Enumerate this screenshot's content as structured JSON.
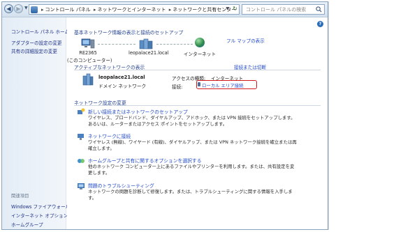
{
  "addressbar": {
    "path": [
      "コントロール パネル",
      "ネットワークとインターネット",
      "ネットワークと共有センター"
    ],
    "search_placeholder": "コントロール パネルの検索"
  },
  "sidebar": {
    "home": "コントロール パネル ホーム",
    "items": [
      "アダプターの設定の変更",
      "共有の詳細設定の変更"
    ],
    "related_heading": "関連項目",
    "related": [
      "Windows ファイアウォール",
      "インターネット オプション",
      "ホームグループ"
    ]
  },
  "main": {
    "basic_heading": "基本ネットワーク情報の表示と接続のセットアップ",
    "full_map_link": "フル マップの表示",
    "map": {
      "computer_name": "RE2365",
      "computer_sub": "(このコンピューター)",
      "network": "leopalace21.local",
      "internet": "インターネット"
    },
    "active_heading": "アクティブなネットワークの表示",
    "connect_link": "接続または切断",
    "active": {
      "name": "leopalace21.local",
      "type": "ドメイン ネットワーク",
      "access_label": "アクセスの種類:",
      "access_value": "インターネット",
      "connection_label": "接続:",
      "connection_value": "ローカル エリア接続"
    },
    "change_heading": "ネットワーク設定の変更",
    "tasks": [
      {
        "link": "新しい接続またはネットワークのセットアップ",
        "desc": "ワイヤレス、ブロードバンド、ダイヤルアップ、アドホック、または VPN 接続をセットアップします。あるいは、ルーターまたはアクセス ポイントをセットアップします。"
      },
      {
        "link": "ネットワークに接続",
        "desc": "ワイヤレス (無線)、ワイヤード (有線)、ダイヤルアップ、または VPN ネットワーク接続を確立または再確立します。"
      },
      {
        "link": "ホームグループと共有に関するオプションを選択する",
        "desc": "他のネットワーク コンピューター上にあるファイルやプリンターを利用します。または、共有設定を変更します。"
      },
      {
        "link": "問題のトラブルシューティング",
        "desc": "ネットワークの問題を診断して修復します。または、トラブルシューティングに関する情報を入手します。"
      }
    ]
  },
  "colors": {
    "link": "#1e47c8",
    "heading": "#1d3d8c",
    "highlight_box": "#d21a1a"
  }
}
